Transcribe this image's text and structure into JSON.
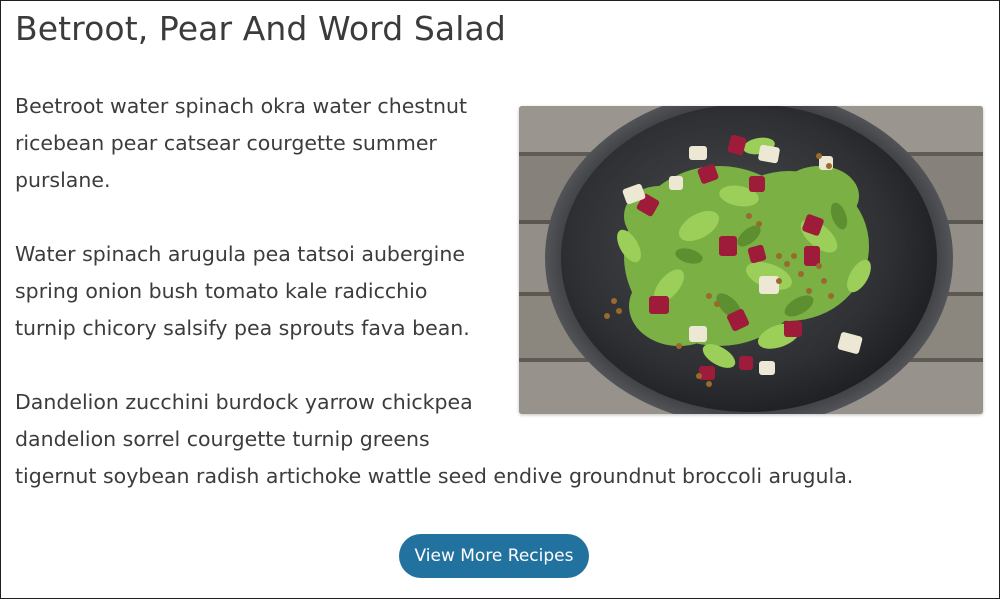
{
  "article": {
    "title": "Betroot, Pear And Word Salad",
    "paragraphs": [
      "Beetroot water spinach okra water chestnut ricebean pear catsear courgette summer purslane.",
      "Water spinach arugula pea tatsoi aubergine spring onion bush tomato kale radicchio turnip chicory salsify pea sprouts fava bean.",
      "Dandelion zucchini burdock yarrow chickpea dandelion sorrel courgette turnip greens tigernut soybean radish artichoke wattle seed endive groundnut broccoli arugula."
    ]
  },
  "cta": {
    "label": "View More Recipes"
  },
  "colors": {
    "button": "#2272a0",
    "text": "#3c3c3c"
  }
}
